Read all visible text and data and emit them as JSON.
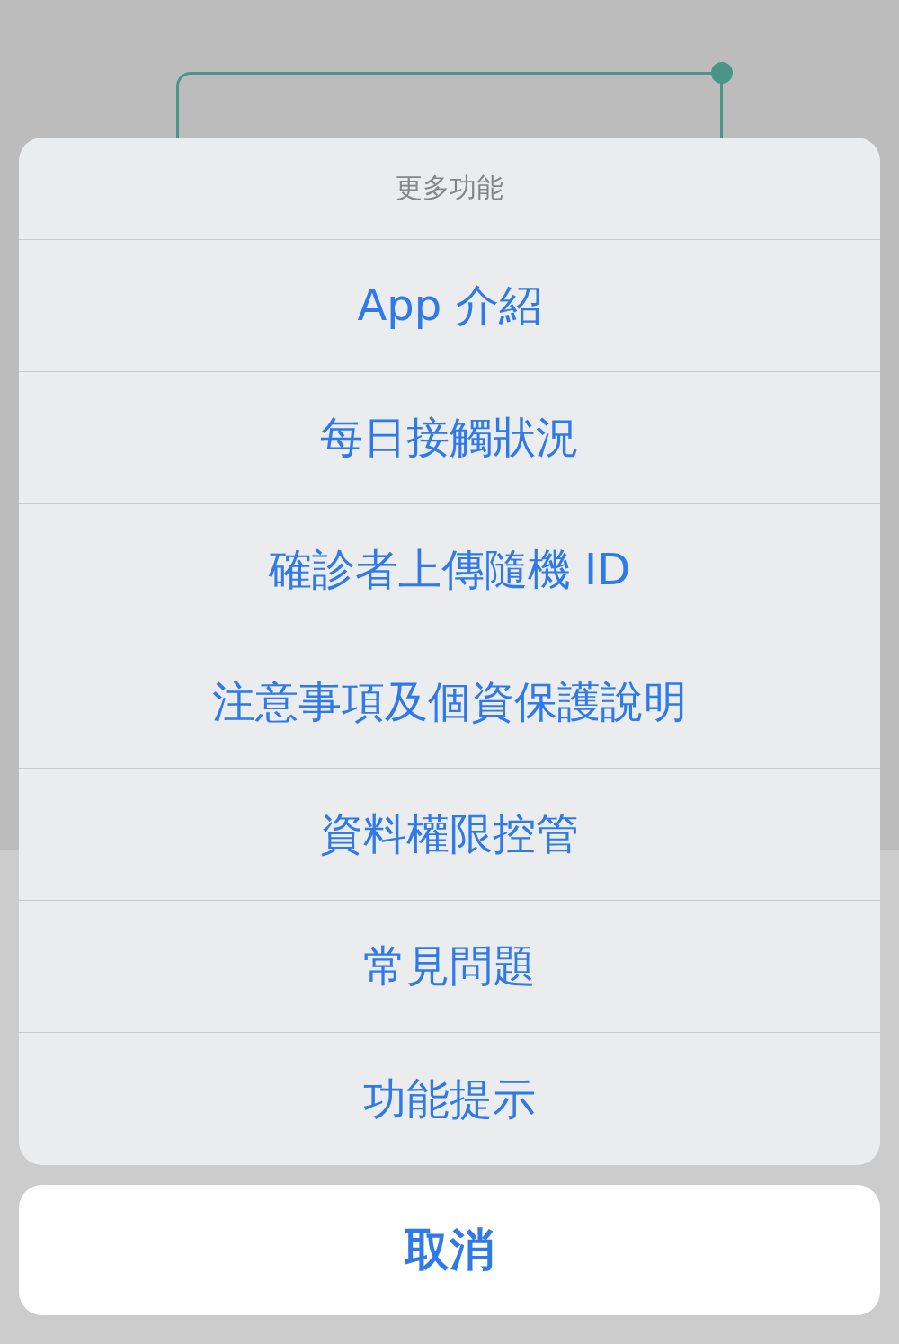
{
  "action_sheet": {
    "title": "更多功能",
    "items": [
      {
        "label": "App 介紹"
      },
      {
        "label": "每日接觸狀況"
      },
      {
        "label": "確診者上傳隨機 ID"
      },
      {
        "label": "注意事項及個資保護說明"
      },
      {
        "label": "資料權限控管"
      },
      {
        "label": "常見問題"
      },
      {
        "label": "功能提示"
      }
    ],
    "cancel": "取消"
  }
}
